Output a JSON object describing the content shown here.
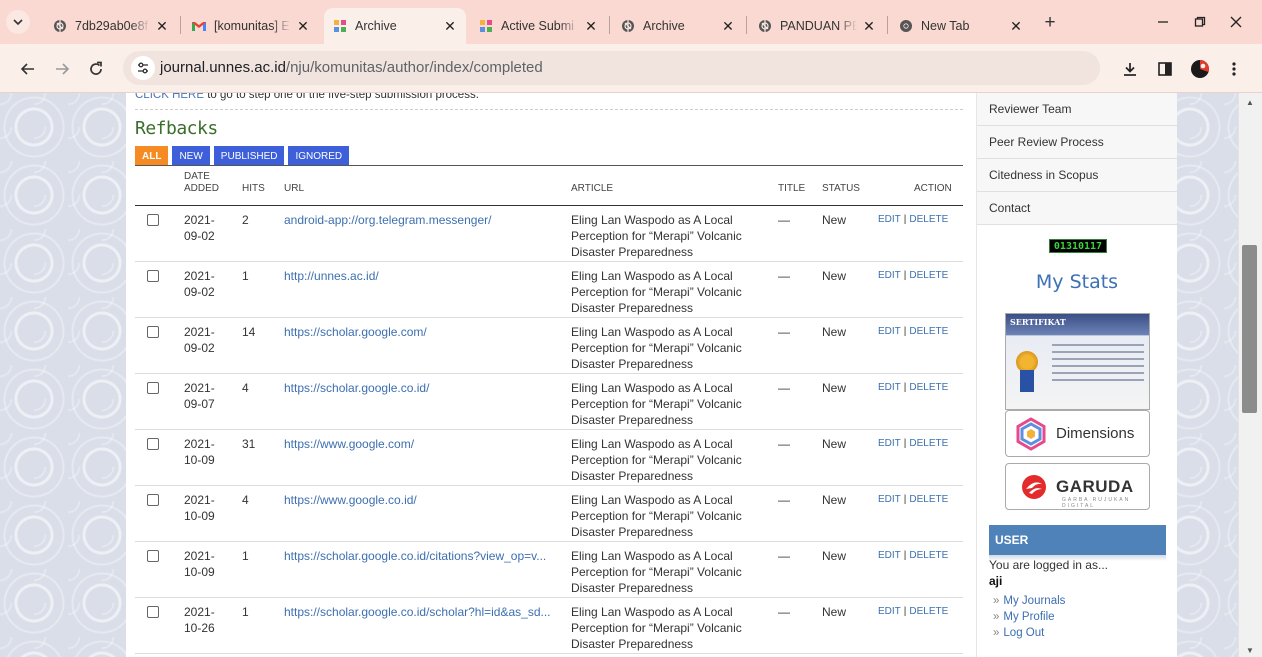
{
  "browser": {
    "tabs": [
      {
        "title": "7db29ab0e8f",
        "favicon": "globe-icon",
        "active": false
      },
      {
        "title": "[komunitas] E",
        "favicon": "gmail-icon",
        "active": false
      },
      {
        "title": "Archive",
        "favicon": "ojs-icon",
        "active": true
      },
      {
        "title": "Active Submi",
        "favicon": "ojs-icon",
        "active": false
      },
      {
        "title": "Archive",
        "favicon": "globe-icon",
        "active": false
      },
      {
        "title": "PANDUAN PE",
        "favicon": "globe-icon",
        "active": false
      },
      {
        "title": "New Tab",
        "favicon": "chrome-icon",
        "active": false
      }
    ],
    "url_host": "journal.unnes.ac.id",
    "url_path": "/nju/komunitas/author/index/completed",
    "colors": {
      "tabstrip": "#f9d9d1",
      "toolbar": "#fbefea"
    }
  },
  "page": {
    "help_link": "CLICK HERE",
    "help_text": " to go to step one of the five-step submission process.",
    "section_title": "Refbacks",
    "filter_tabs": [
      {
        "label": "ALL",
        "active": true
      },
      {
        "label": "NEW",
        "active": false
      },
      {
        "label": "PUBLISHED",
        "active": false
      },
      {
        "label": "IGNORED",
        "active": false
      }
    ],
    "columns": {
      "date_line1": "DATE",
      "date_line2": "ADDED",
      "hits": "HITS",
      "url": "URL",
      "article": "ARTICLE",
      "title": "TITLE",
      "status": "STATUS",
      "action": "ACTION"
    },
    "rows": [
      {
        "date1": "2021-",
        "date2": "09-02",
        "hits": "2",
        "url": "android-app://org.telegram.messenger/",
        "article": "Eling Lan Waspodo as A Local Perception for “Merapi” Volcanic Disaster Preparedness",
        "title": "—",
        "status": "New",
        "edit": "EDIT",
        "delete": "DELETE"
      },
      {
        "date1": "2021-",
        "date2": "09-02",
        "hits": "1",
        "url": "http://unnes.ac.id/",
        "article": "Eling Lan Waspodo as A Local Perception for “Merapi” Volcanic Disaster Preparedness",
        "title": "—",
        "status": "New",
        "edit": "EDIT",
        "delete": "DELETE"
      },
      {
        "date1": "2021-",
        "date2": "09-02",
        "hits": "14",
        "url": "https://scholar.google.com/",
        "article": "Eling Lan Waspodo as A Local Perception for “Merapi” Volcanic Disaster Preparedness",
        "title": "—",
        "status": "New",
        "edit": "EDIT",
        "delete": "DELETE"
      },
      {
        "date1": "2021-",
        "date2": "09-07",
        "hits": "4",
        "url": "https://scholar.google.co.id/",
        "article": "Eling Lan Waspodo as A Local Perception for “Merapi” Volcanic Disaster Preparedness",
        "title": "—",
        "status": "New",
        "edit": "EDIT",
        "delete": "DELETE"
      },
      {
        "date1": "2021-",
        "date2": "10-09",
        "hits": "31",
        "url": "https://www.google.com/",
        "article": "Eling Lan Waspodo as A Local Perception for “Merapi” Volcanic Disaster Preparedness",
        "title": "—",
        "status": "New",
        "edit": "EDIT",
        "delete": "DELETE"
      },
      {
        "date1": "2021-",
        "date2": "10-09",
        "hits": "4",
        "url": "https://www.google.co.id/",
        "article": "Eling Lan Waspodo as A Local Perception for “Merapi” Volcanic Disaster Preparedness",
        "title": "—",
        "status": "New",
        "edit": "EDIT",
        "delete": "DELETE"
      },
      {
        "date1": "2021-",
        "date2": "10-09",
        "hits": "1",
        "url": "https://scholar.google.co.id/citations?view_op=v...",
        "article": "Eling Lan Waspodo as A Local Perception for “Merapi” Volcanic Disaster Preparedness",
        "title": "—",
        "status": "New",
        "edit": "EDIT",
        "delete": "DELETE"
      },
      {
        "date1": "2021-",
        "date2": "10-26",
        "hits": "1",
        "url": "https://scholar.google.co.id/scholar?hl=id&as_sd...",
        "article": "Eling Lan Waspodo as A Local Perception for “Merapi” Volcanic Disaster Preparedness",
        "title": "—",
        "status": "New",
        "edit": "EDIT",
        "delete": "DELETE"
      }
    ]
  },
  "sidebar": {
    "links": [
      "Reviewer Team",
      "Peer Review Process",
      "Citedness in Scopus",
      "Contact"
    ],
    "counter": "01310117",
    "stats_title": "My Stats",
    "certificate_label": "SERTIFIKAT",
    "dimensions_label": "Dimensions",
    "garuda_label": "GARUDA",
    "garuda_sub": "GARBA RUJUKAN DIGITAL",
    "user_heading": "USER",
    "logged_in_text": "You are logged in as...",
    "username": "aji",
    "user_links": [
      "My Journals",
      "My Profile",
      "Log Out"
    ]
  }
}
